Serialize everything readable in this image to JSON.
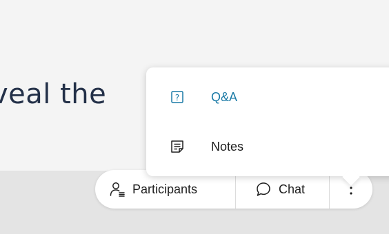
{
  "slide": {
    "visible_text": "veal the"
  },
  "controls": {
    "participants_label": "Participants",
    "chat_label": "Chat",
    "more_icon": "vertical-ellipsis-icon"
  },
  "menu": {
    "items": [
      {
        "label": "Q&A",
        "icon": "question-box-icon",
        "color": "#1a7aa6"
      },
      {
        "label": "Notes",
        "icon": "notes-icon",
        "color": "#1e1e1e"
      }
    ]
  }
}
